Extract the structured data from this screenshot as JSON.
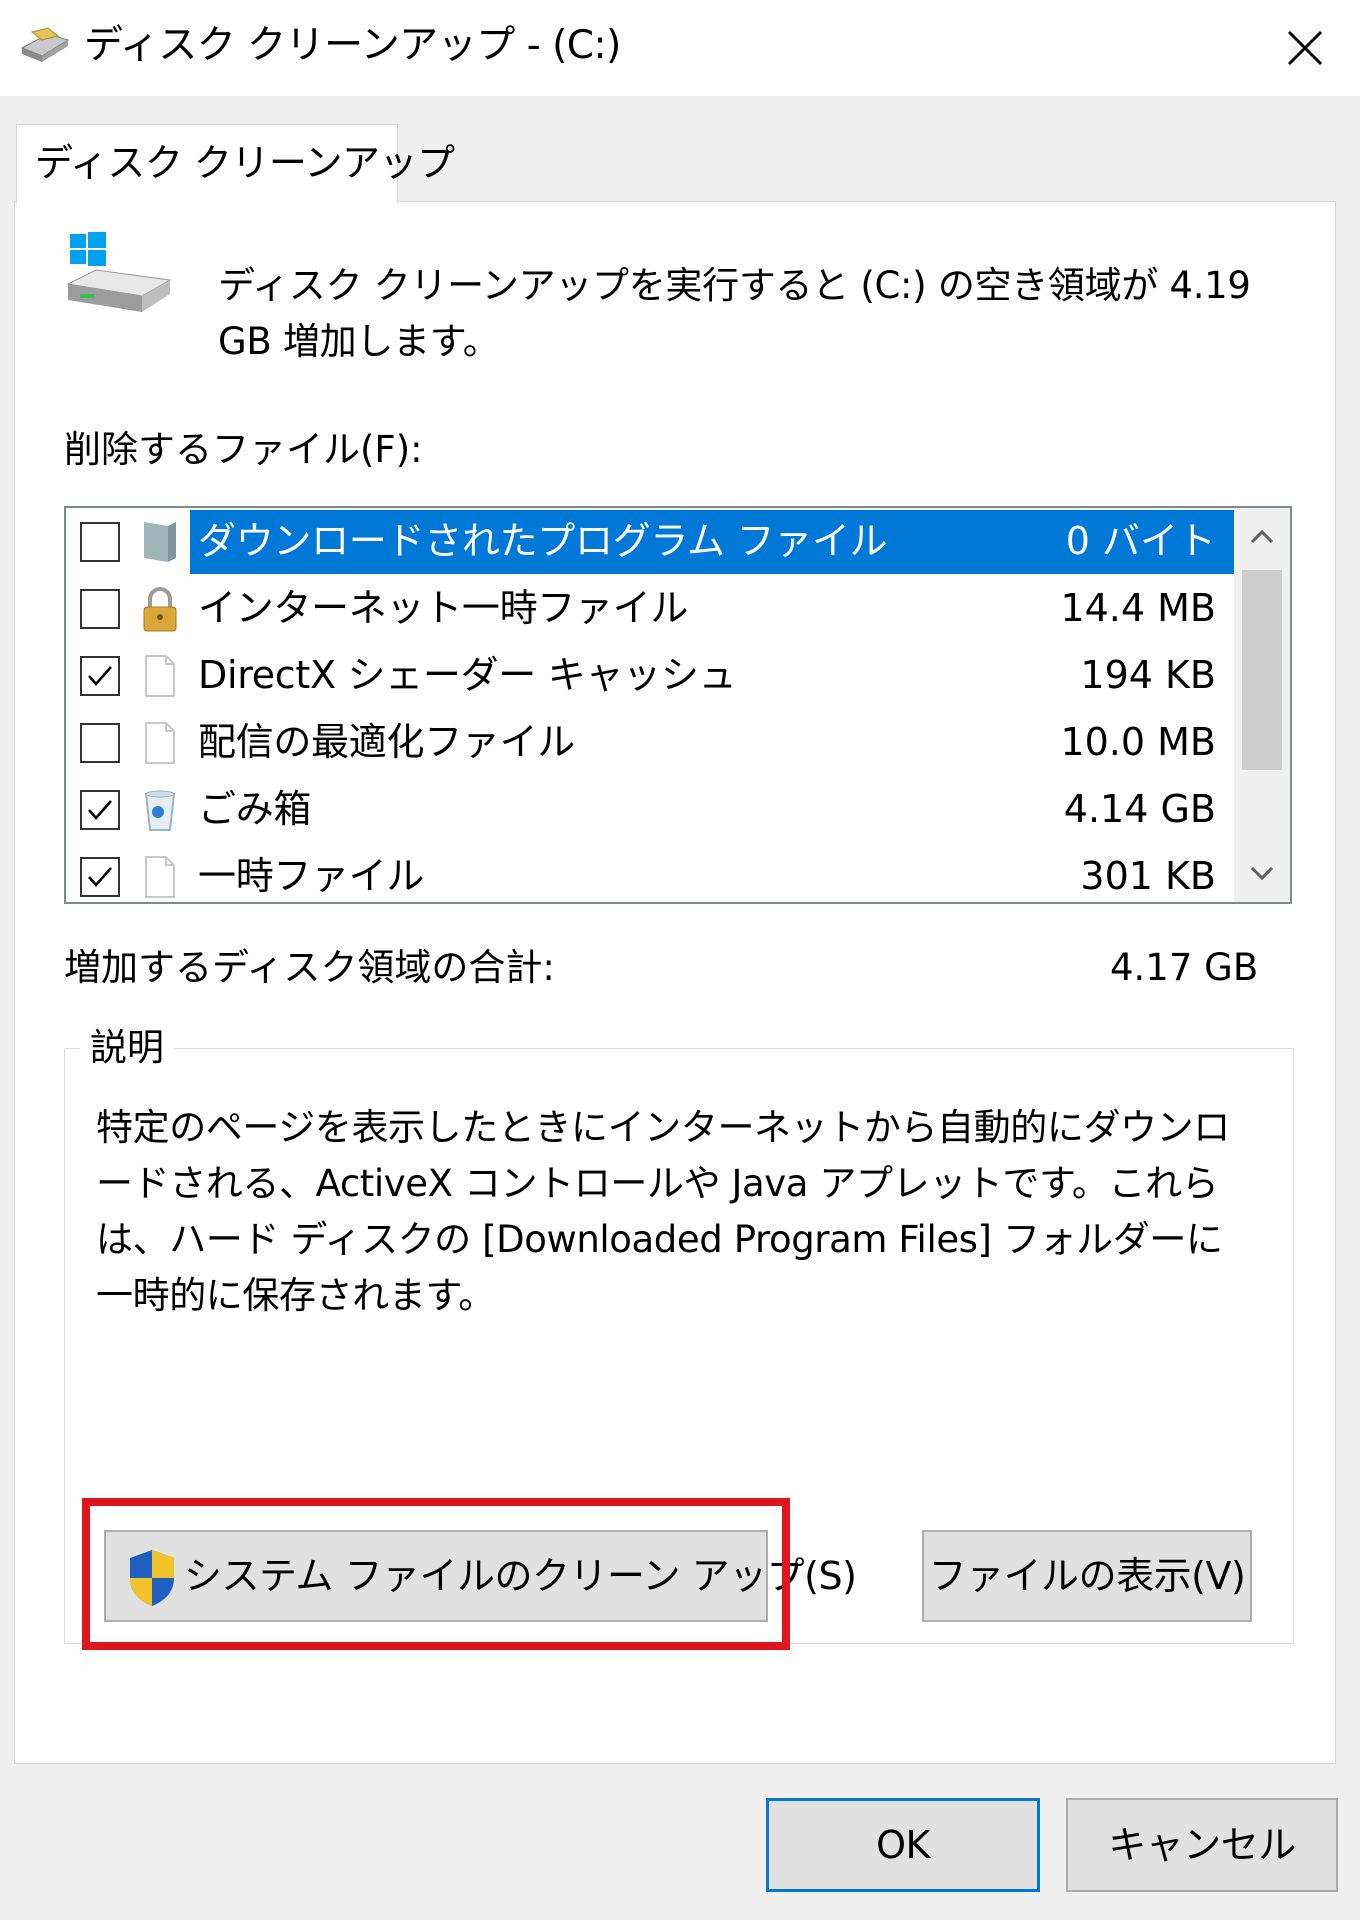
{
  "window": {
    "title": "ディスク クリーンアップ - (C:)",
    "app_icon": "disk-cleanup-icon",
    "close_icon": "close-icon"
  },
  "tabs": [
    {
      "label": "ディスク クリーンアップ",
      "active": true
    }
  ],
  "summary": {
    "text": "ディスク クリーンアップを実行すると (C:) の空き領域が 4.19 GB 増加します。",
    "icon": "drive-icon"
  },
  "files_list": {
    "label": "削除するファイル(F):",
    "items": [
      {
        "name": "ダウンロードされたプログラム ファイル",
        "size": "0 バイト",
        "checked": false,
        "selected": true,
        "icon": "folder-icon"
      },
      {
        "name": "インターネット一時ファイル",
        "size": "14.4 MB",
        "checked": false,
        "selected": false,
        "icon": "lock-icon"
      },
      {
        "name": "DirectX シェーダー キャッシュ",
        "size": "194 KB",
        "checked": true,
        "selected": false,
        "icon": "file-icon"
      },
      {
        "name": "配信の最適化ファイル",
        "size": "10.0 MB",
        "checked": false,
        "selected": false,
        "icon": "file-icon"
      },
      {
        "name": "ごみ箱",
        "size": "4.14 GB",
        "checked": true,
        "selected": false,
        "icon": "recycle-bin-icon"
      },
      {
        "name": "一時ファイル",
        "size": "301 KB",
        "checked": true,
        "selected": false,
        "icon": "file-icon"
      }
    ]
  },
  "total": {
    "label": "増加するディスク領域の合計:",
    "value": "4.17 GB"
  },
  "description": {
    "title": "説明",
    "text": "特定のページを表示したときにインターネットから自動的にダウンロードされる、ActiveX コントロールや Java アプレットです。これらは、ハード ディスクの [Downloaded Program Files] フォルダーに一時的に保存されます。"
  },
  "buttons": {
    "cleanup_system": "システム ファイルのクリーン アップ(S)",
    "view_files": "ファイルの表示(V)",
    "ok": "OK",
    "cancel": "キャンセル"
  },
  "colors": {
    "selection": "#0078d7",
    "highlight_box": "#e0161e",
    "default_button_border": "#0078d7"
  }
}
